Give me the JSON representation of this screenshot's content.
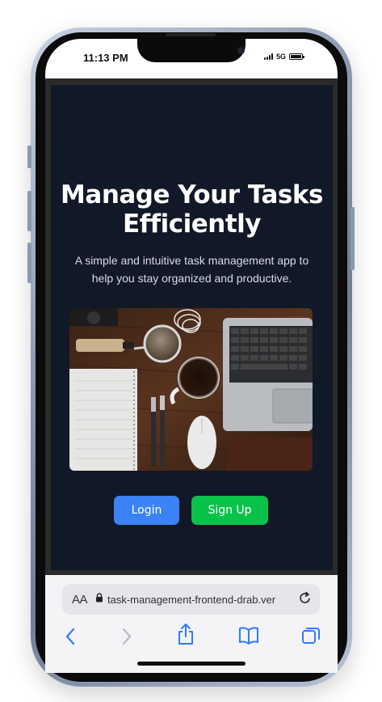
{
  "status_bar": {
    "time": "11:13 PM",
    "network": "5G"
  },
  "hero": {
    "title": "Manage Your Tasks Efficiently",
    "subtitle": "A simple and intuitive task management app to help you stay organized and productive."
  },
  "buttons": {
    "login": "Login",
    "signup": "Sign Up"
  },
  "browser": {
    "text_size_label": "AA",
    "url": "task-management-frontend-drab.ver"
  },
  "colors": {
    "page_bg": "#111827",
    "login_button": "#3b82f6",
    "signup_button": "#0ac24a",
    "safari_accent": "#2f7bf6"
  },
  "icons": {
    "lock": "lock-icon",
    "reload": "reload-icon",
    "back": "chevron-left-icon",
    "forward": "chevron-right-icon",
    "share": "share-icon",
    "bookmarks": "book-icon",
    "tabs": "tabs-icon"
  }
}
